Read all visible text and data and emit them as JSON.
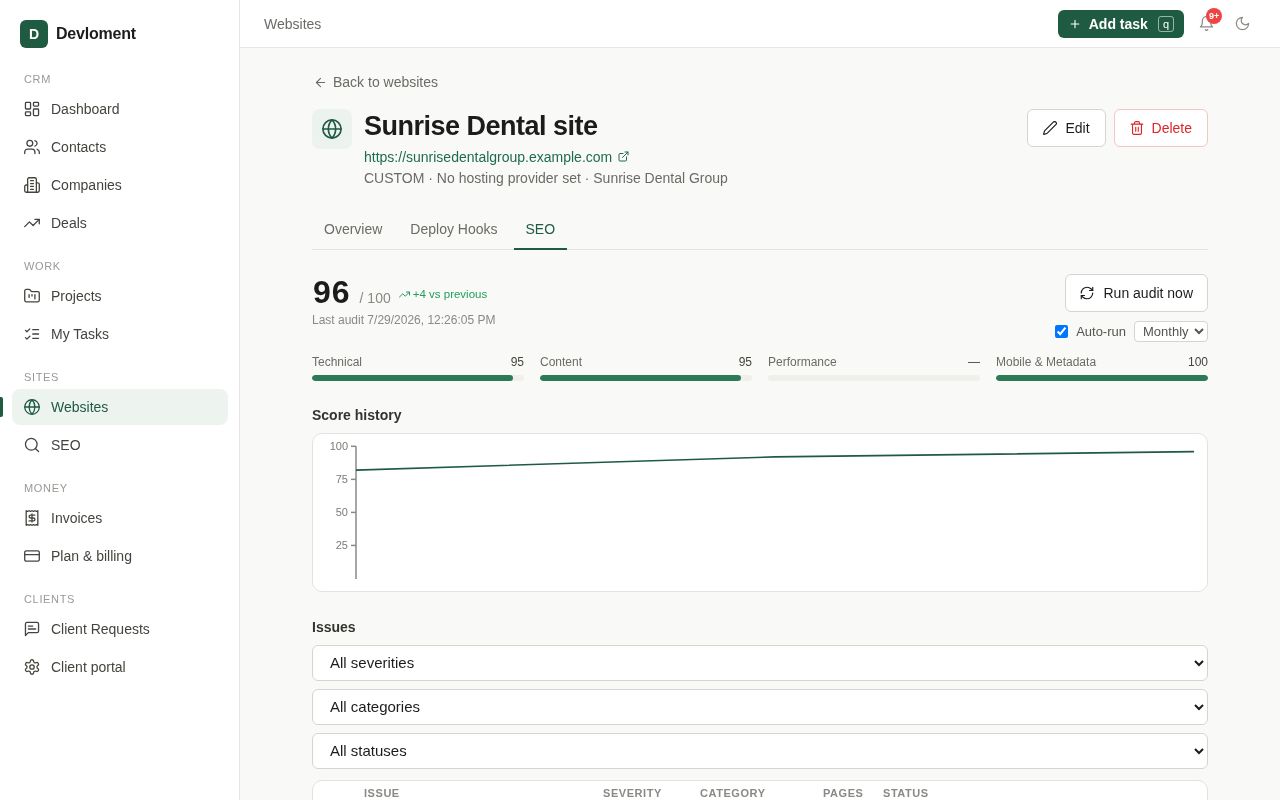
{
  "sidebar": {
    "brand": {
      "initial": "D",
      "name": "Devloment"
    },
    "sections": [
      {
        "label": "CRM",
        "items": [
          {
            "label": "Dashboard",
            "selected": false
          },
          {
            "label": "Contacts",
            "selected": false
          },
          {
            "label": "Companies",
            "selected": false
          },
          {
            "label": "Deals",
            "selected": false
          }
        ]
      },
      {
        "label": "WORK",
        "items": [
          {
            "label": "Projects",
            "selected": false
          },
          {
            "label": "My Tasks",
            "selected": false
          }
        ]
      },
      {
        "label": "SITES",
        "items": [
          {
            "label": "Websites",
            "selected": true
          },
          {
            "label": "SEO",
            "selected": false
          }
        ]
      },
      {
        "label": "MONEY",
        "items": [
          {
            "label": "Invoices",
            "selected": false
          },
          {
            "label": "Plan & billing",
            "selected": false
          }
        ]
      },
      {
        "label": "CLIENTS",
        "items": [
          {
            "label": "Client Requests",
            "selected": false
          },
          {
            "label": "Client portal",
            "selected": false
          }
        ]
      }
    ]
  },
  "topbar": {
    "breadcrumb": "Websites",
    "add_task": {
      "label": "Add task",
      "shortcut": "q"
    },
    "notifications": {
      "badge": "9+"
    }
  },
  "site": {
    "back_link": "Back to websites",
    "title": "Sunrise Dental site",
    "url": "https://sunrisedentalgroup.example.com",
    "meta": "CUSTOM · No hosting provider set · Sunrise Dental Group",
    "actions": [
      {
        "label": "Edit",
        "kind": "edit"
      },
      {
        "label": "Delete",
        "kind": "delete"
      }
    ]
  },
  "tabs": [
    {
      "label": "Overview",
      "selected": false
    },
    {
      "label": "Deploy Hooks",
      "selected": false
    },
    {
      "label": "SEO",
      "selected": true
    }
  ],
  "seo": {
    "score": "96",
    "out_of": "/ 100",
    "trend": "+4 vs previous",
    "last_audit": "Last audit 7/29/2026, 12:26:05 PM",
    "run_button": "Run audit now",
    "auto_run": {
      "label": "Auto-run",
      "checked": true,
      "frequency": "Monthly"
    },
    "categories": [
      {
        "name": "Technical",
        "value": "95",
        "level": 0.95
      },
      {
        "name": "Content",
        "value": "95",
        "level": 0.95
      },
      {
        "name": "Performance",
        "value": "—"
      },
      {
        "name": "Mobile & Metadata",
        "value": "100",
        "level": 1
      }
    ],
    "history": {
      "title": "Score history",
      "axis_labels": [
        "100",
        "75",
        "50",
        "25"
      ]
    }
  },
  "issues": {
    "title": "Issues",
    "filters": [
      "All severities",
      "All categories",
      "All statuses"
    ],
    "table": {
      "columns": [
        "ISSUE",
        "SEVERITY",
        "CATEGORY",
        "PAGES",
        "STATUS"
      ]
    }
  }
}
